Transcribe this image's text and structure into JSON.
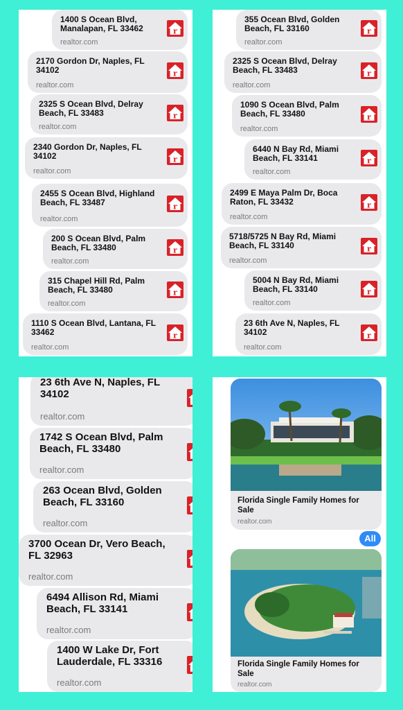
{
  "domain": "realtor.com",
  "panel1": [
    {
      "address": "1400 S Ocean Blvd, Manalapan, FL 33462"
    },
    {
      "address": "2170 Gordon Dr, Naples, FL 34102"
    },
    {
      "address": "2325 S Ocean Blvd, Delray Beach, FL 33483"
    },
    {
      "address": "2340 Gordon Dr, Naples, FL 34102"
    },
    {
      "address": "2455 S Ocean Blvd, Highland Beach, FL 33487"
    },
    {
      "address": "200 S Ocean Blvd, Palm Beach, FL 33480"
    },
    {
      "address": "315 Chapel Hill Rd, Palm Beach, FL 33480"
    },
    {
      "address": "1110 S Ocean Blvd, Lantana, FL 33462"
    }
  ],
  "panel2": [
    {
      "address": "355 Ocean Blvd, Golden Beach, FL 33160"
    },
    {
      "address": "2325 S Ocean Blvd, Delray Beach, FL 33483"
    },
    {
      "address": "1090 S Ocean Blvd, Palm Beach, FL 33480"
    },
    {
      "address": "6440 N Bay Rd, Miami Beach, FL 33141"
    },
    {
      "address": "2499 E Maya Palm Dr, Boca Raton, FL 33432"
    },
    {
      "address": "5718/5725 N Bay Rd, Miami Beach, FL 33140"
    },
    {
      "address": "5004 N Bay Rd, Miami Beach, FL 33140"
    },
    {
      "address": "23 6th Ave N, Naples, FL 34102"
    }
  ],
  "panel3": [
    {
      "address": "23 6th Ave N, Naples, FL 34102"
    },
    {
      "address": "1742 S Ocean Blvd, Palm Beach, FL 33480"
    },
    {
      "address": "263 Ocean Blvd, Golden Beach, FL 33160"
    },
    {
      "address": "3700 Ocean Dr, Vero Beach, FL 32963"
    },
    {
      "address": "6494 Allison Rd, Miami Beach, FL 33141"
    },
    {
      "address": "1400 W Lake Dr, Fort Lauderdale, FL 33316"
    }
  ],
  "panel4": {
    "cards": [
      {
        "title": "Florida Single Family Homes for Sale",
        "source": "realtor.com",
        "image": "modern-waterfront-house-photo"
      },
      {
        "title": "Florida Single Family Homes for Sale",
        "source": "realtor.com",
        "image": "aerial-island-estate-photo"
      }
    ],
    "all_button": "All"
  },
  "colors": {
    "background": "#3ff0d6",
    "bubble": "#e9e9eb",
    "realtor_red": "#d92228",
    "ios_blue": "#2f8cf7"
  },
  "icons": [
    "realtor-logo-icon"
  ]
}
